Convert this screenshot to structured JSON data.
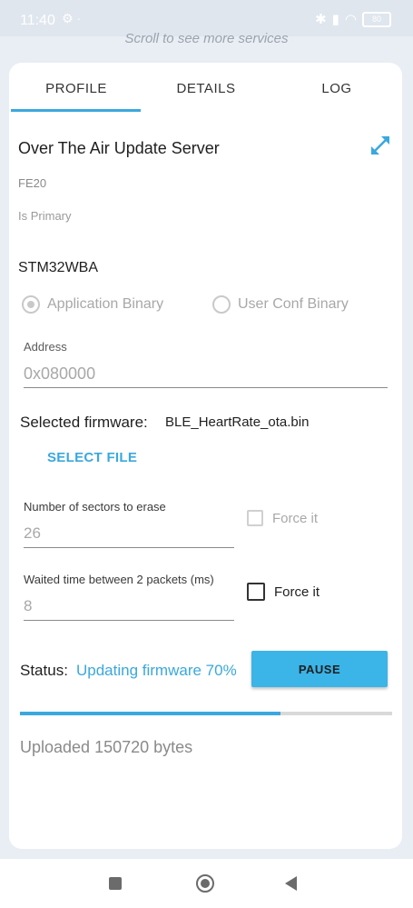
{
  "status_bar": {
    "time": "11:40",
    "battery": "80"
  },
  "scroll_hint": "Scroll to see more services",
  "tabs": [
    {
      "label": "PROFILE",
      "active": true
    },
    {
      "label": "DETAILS",
      "active": false
    },
    {
      "label": "LOG",
      "active": false
    }
  ],
  "service": {
    "title": "Over The Air Update Server",
    "uuid": "FE20",
    "primary": "Is Primary"
  },
  "device_name": "STM32WBA",
  "binary_type": {
    "options": [
      "Application Binary",
      "User Conf Binary"
    ],
    "selected": "Application Binary"
  },
  "address": {
    "label": "Address",
    "value": "0x080000"
  },
  "firmware": {
    "label": "Selected firmware:",
    "value": "BLE_HeartRate_ota.bin",
    "select_button": "SELECT FILE"
  },
  "sectors": {
    "label": "Number of sectors to erase",
    "value": "26",
    "force_label": "Force it",
    "force_checked": false
  },
  "wait_time": {
    "label": "Waited time between 2 packets (ms)",
    "value": "8",
    "force_label": "Force it",
    "force_checked": false
  },
  "status": {
    "label": "Status:",
    "value": "Updating firmware 70%",
    "pause_button": "PAUSE",
    "progress_percent": 70
  },
  "uploaded": "Uploaded 150720 bytes",
  "colors": {
    "accent": "#3aa8de",
    "button": "#3bb4e8",
    "card": "#ffffff",
    "background": "#e9eef4"
  },
  "icons": {
    "expand": "expand-arrows-icon",
    "nav_square": "recent-apps-icon",
    "nav_circle": "home-icon",
    "nav_back": "back-icon"
  }
}
